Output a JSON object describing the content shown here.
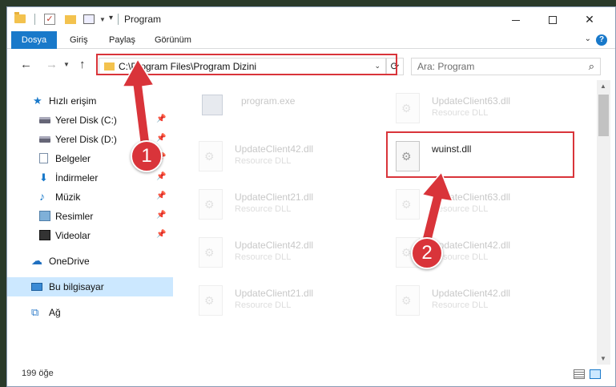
{
  "window": {
    "title": "Program"
  },
  "ribbon": {
    "tabs": [
      "Dosya",
      "Giriş",
      "Paylaş",
      "Görünüm"
    ]
  },
  "address_bar": {
    "path": "C:\\Program Files\\Program Dizini"
  },
  "search": {
    "placeholder": "Ara: Program"
  },
  "sidebar": {
    "items": [
      {
        "label": "Hızlı erişim",
        "icon": "star-icon",
        "pinned": false
      },
      {
        "label": "Yerel Disk (C:)",
        "icon": "disk-icon",
        "pinned": true
      },
      {
        "label": "Yerel Disk (D:)",
        "icon": "disk-icon",
        "pinned": true
      },
      {
        "label": "Belgeler",
        "icon": "document-icon",
        "pinned": true
      },
      {
        "label": "İndirmeler",
        "icon": "download-icon",
        "pinned": true
      },
      {
        "label": "Müzik",
        "icon": "music-icon",
        "pinned": true
      },
      {
        "label": "Resimler",
        "icon": "pictures-icon",
        "pinned": true
      },
      {
        "label": "Videolar",
        "icon": "video-icon",
        "pinned": true
      },
      {
        "label": "OneDrive",
        "icon": "cloud-icon",
        "pinned": false
      },
      {
        "label": "Bu bilgisayar",
        "icon": "computer-icon",
        "pinned": false,
        "selected": true
      },
      {
        "label": "Ağ",
        "icon": "network-icon",
        "pinned": false
      }
    ]
  },
  "files": [
    {
      "name": "program.exe",
      "type": "",
      "faded": true
    },
    {
      "name": "UpdateClient63.dll",
      "type": "Resource DLL",
      "faded": true
    },
    {
      "name": "UpdateClient42.dll",
      "type": "Resource DLL",
      "faded": true
    },
    {
      "name": "wuinst.dll",
      "type": "",
      "faded": false
    },
    {
      "name": "UpdateClient21.dll",
      "type": "Resource DLL",
      "faded": true
    },
    {
      "name": "UpdateClient63.dll",
      "type": "Resource DLL",
      "faded": true
    },
    {
      "name": "UpdateClient42.dll",
      "type": "Resource DLL",
      "faded": true
    },
    {
      "name": "UpdateClient42.dll",
      "type": "Resource DLL",
      "faded": true
    },
    {
      "name": "UpdateClient21.dll",
      "type": "Resource DLL",
      "faded": true
    },
    {
      "name": "UpdateClient42.dll",
      "type": "Resource DLL",
      "faded": true
    }
  ],
  "status": {
    "item_count": "199 öğe"
  },
  "callouts": {
    "step1": "1",
    "step2": "2"
  },
  "colors": {
    "accent": "#1979ca",
    "highlight": "#d9343a",
    "selection": "#cce8ff"
  }
}
